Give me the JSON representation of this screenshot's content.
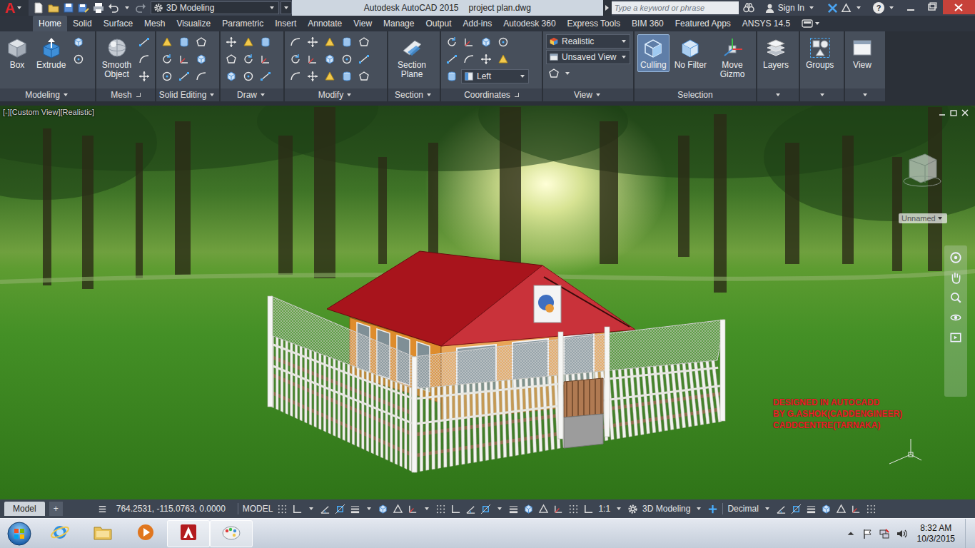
{
  "title_bar": {
    "logo": "A",
    "workspace": "3D Modeling",
    "app_title": "Autodesk AutoCAD 2015",
    "file_name": "project plan.dwg",
    "search": {
      "placeholder": "Type a keyword or phrase"
    },
    "sign_in": "Sign In",
    "help": "?"
  },
  "ribbon_tabs": [
    {
      "label": "Home",
      "selected": true
    },
    {
      "label": "Solid",
      "selected": false
    },
    {
      "label": "Surface",
      "selected": false
    },
    {
      "label": "Mesh",
      "selected": false
    },
    {
      "label": "Visualize",
      "selected": false
    },
    {
      "label": "Parametric",
      "selected": false
    },
    {
      "label": "Insert",
      "selected": false
    },
    {
      "label": "Annotate",
      "selected": false
    },
    {
      "label": "View",
      "selected": false
    },
    {
      "label": "Manage",
      "selected": false
    },
    {
      "label": "Output",
      "selected": false
    },
    {
      "label": "Add-ins",
      "selected": false
    },
    {
      "label": "Autodesk 360",
      "selected": false
    },
    {
      "label": "Express Tools",
      "selected": false
    },
    {
      "label": "BIM 360",
      "selected": false
    },
    {
      "label": "Featured Apps",
      "selected": false
    },
    {
      "label": "ANSYS 14.5",
      "selected": false
    }
  ],
  "ribbon_panels": [
    {
      "title": "Modeling",
      "large_buttons": [
        {
          "label": "Box",
          "active": false
        },
        {
          "label": "Extrude",
          "active": false
        }
      ]
    },
    {
      "title": "Mesh",
      "large_buttons": [
        {
          "label": "Smooth Object",
          "active": false
        }
      ]
    },
    {
      "title": "Solid Editing"
    },
    {
      "title": "Draw"
    },
    {
      "title": "Modify"
    },
    {
      "title": "Section",
      "large_buttons": [
        {
          "label": "Section Plane",
          "active": false
        }
      ]
    },
    {
      "title": "Coordinates",
      "dropdowns": [
        {
          "value": "Left"
        }
      ]
    },
    {
      "title": "View",
      "dropdowns": [
        {
          "value": "Realistic"
        },
        {
          "value": "Unsaved View"
        }
      ]
    },
    {
      "title": "Selection",
      "large_buttons": [
        {
          "label": "Culling",
          "active": true
        },
        {
          "label": "No Filter",
          "active": false
        },
        {
          "label": "Move Gizmo",
          "active": false
        }
      ]
    },
    {
      "large_buttons": [
        {
          "label": "Layers",
          "active": false
        }
      ]
    },
    {
      "large_buttons": [
        {
          "label": "Groups",
          "active": false
        }
      ]
    },
    {
      "large_buttons": [
        {
          "label": "View",
          "active": false
        }
      ]
    }
  ],
  "viewport": {
    "controls": "[-][Custom View][Realistic]",
    "named_view": "Unnamed",
    "credit": [
      "DESIGNED IN AUTOCADD",
      "BY G.ASHOK(CADDENGINEER)",
      "CADDCENTRE(TARNAKA)"
    ]
  },
  "status_bar": {
    "layout_tabs": [
      {
        "label": "Model",
        "selected": true
      }
    ],
    "add_tab": "+",
    "coordinates": "764.2531, -115.0763, 0.0000",
    "space": "MODEL",
    "scale": "1:1",
    "workspace": "3D Modeling",
    "units": "Decimal"
  },
  "taskbar": {
    "apps": [
      {
        "kind": "ie",
        "running": false
      },
      {
        "kind": "explorer",
        "running": false
      },
      {
        "kind": "media",
        "running": false
      },
      {
        "kind": "autocad",
        "running": true
      },
      {
        "kind": "paint",
        "running": true
      }
    ],
    "time": "8:32 AM",
    "date": "10/3/2015"
  }
}
